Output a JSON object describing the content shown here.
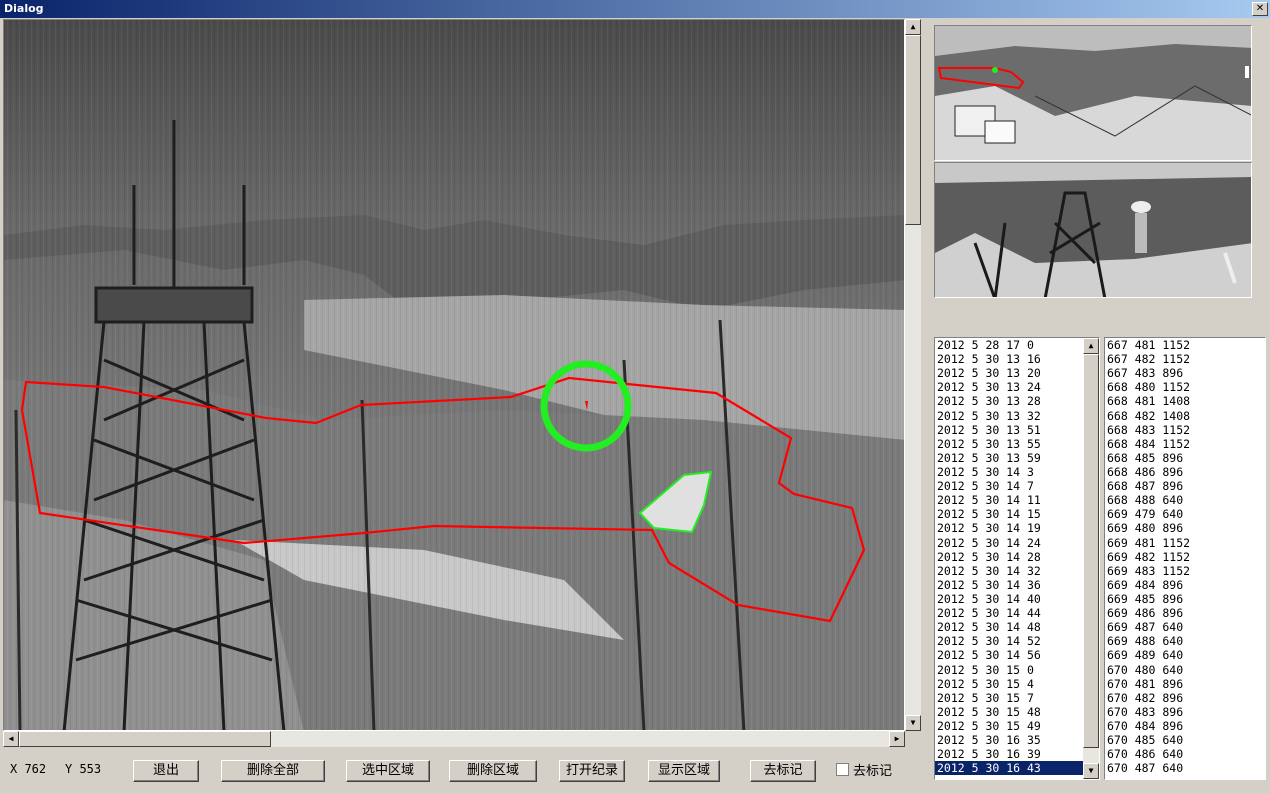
{
  "window": {
    "title": "Dialog",
    "close_glyph": "✕"
  },
  "coords": {
    "x_label": "X 762",
    "y_label": "Y 553"
  },
  "buttons": {
    "exit": "退出",
    "delete_all": "删除全部",
    "select_region": "选中区域",
    "delete_region": "删除区域",
    "open_record": "打开纪录",
    "show_region": "显示区域",
    "remove_mark": "去标记"
  },
  "checkbox": {
    "label": "去标记",
    "checked": false
  },
  "colors": {
    "region_outline": "#ff0000",
    "target_circle": "#22ee22",
    "selection": "#0a246a"
  },
  "icons": [
    "close-icon",
    "scroll-up-arrow-icon",
    "scroll-down-arrow-icon",
    "scroll-left-arrow-icon",
    "scroll-right-arrow-icon"
  ],
  "time_list": [
    "2012 5 28 17 0",
    "2012 5 30 13 16",
    "2012 5 30 13 20",
    "2012 5 30 13 24",
    "2012 5 30 13 28",
    "2012 5 30 13 32",
    "2012 5 30 13 51",
    "2012 5 30 13 55",
    "2012 5 30 13 59",
    "2012 5 30 14 3",
    "2012 5 30 14 7",
    "2012 5 30 14 11",
    "2012 5 30 14 15",
    "2012 5 30 14 19",
    "2012 5 30 14 24",
    "2012 5 30 14 28",
    "2012 5 30 14 32",
    "2012 5 30 14 36",
    "2012 5 30 14 40",
    "2012 5 30 14 44",
    "2012 5 30 14 48",
    "2012 5 30 14 52",
    "2012 5 30 14 56",
    "2012 5 30 15 0",
    "2012 5 30 15 4",
    "2012 5 30 15 7",
    "2012 5 30 15 48",
    "2012 5 30 15 49",
    "2012 5 30 16 35",
    "2012 5 30 16 39",
    "2012 5 30 16 43"
  ],
  "time_list_selected": 30,
  "point_list": [
    "667 481 1152",
    "667 482 1152",
    "667 483 896",
    "668 480 1152",
    "668 481 1408",
    "668 482 1408",
    "668 483 1152",
    "668 484 1152",
    "668 485 896",
    "668 486 896",
    "668 487 896",
    "668 488 640",
    "669 479 640",
    "669 480 896",
    "669 481 1152",
    "669 482 1152",
    "669 483 1152",
    "669 484 896",
    "669 485 896",
    "669 486 896",
    "669 487 640",
    "669 488 640",
    "669 489 640",
    "670 480 640",
    "670 481 896",
    "670 482 896",
    "670 483 896",
    "670 484 896",
    "670 485 640",
    "670 486 640",
    "670 487 640"
  ]
}
